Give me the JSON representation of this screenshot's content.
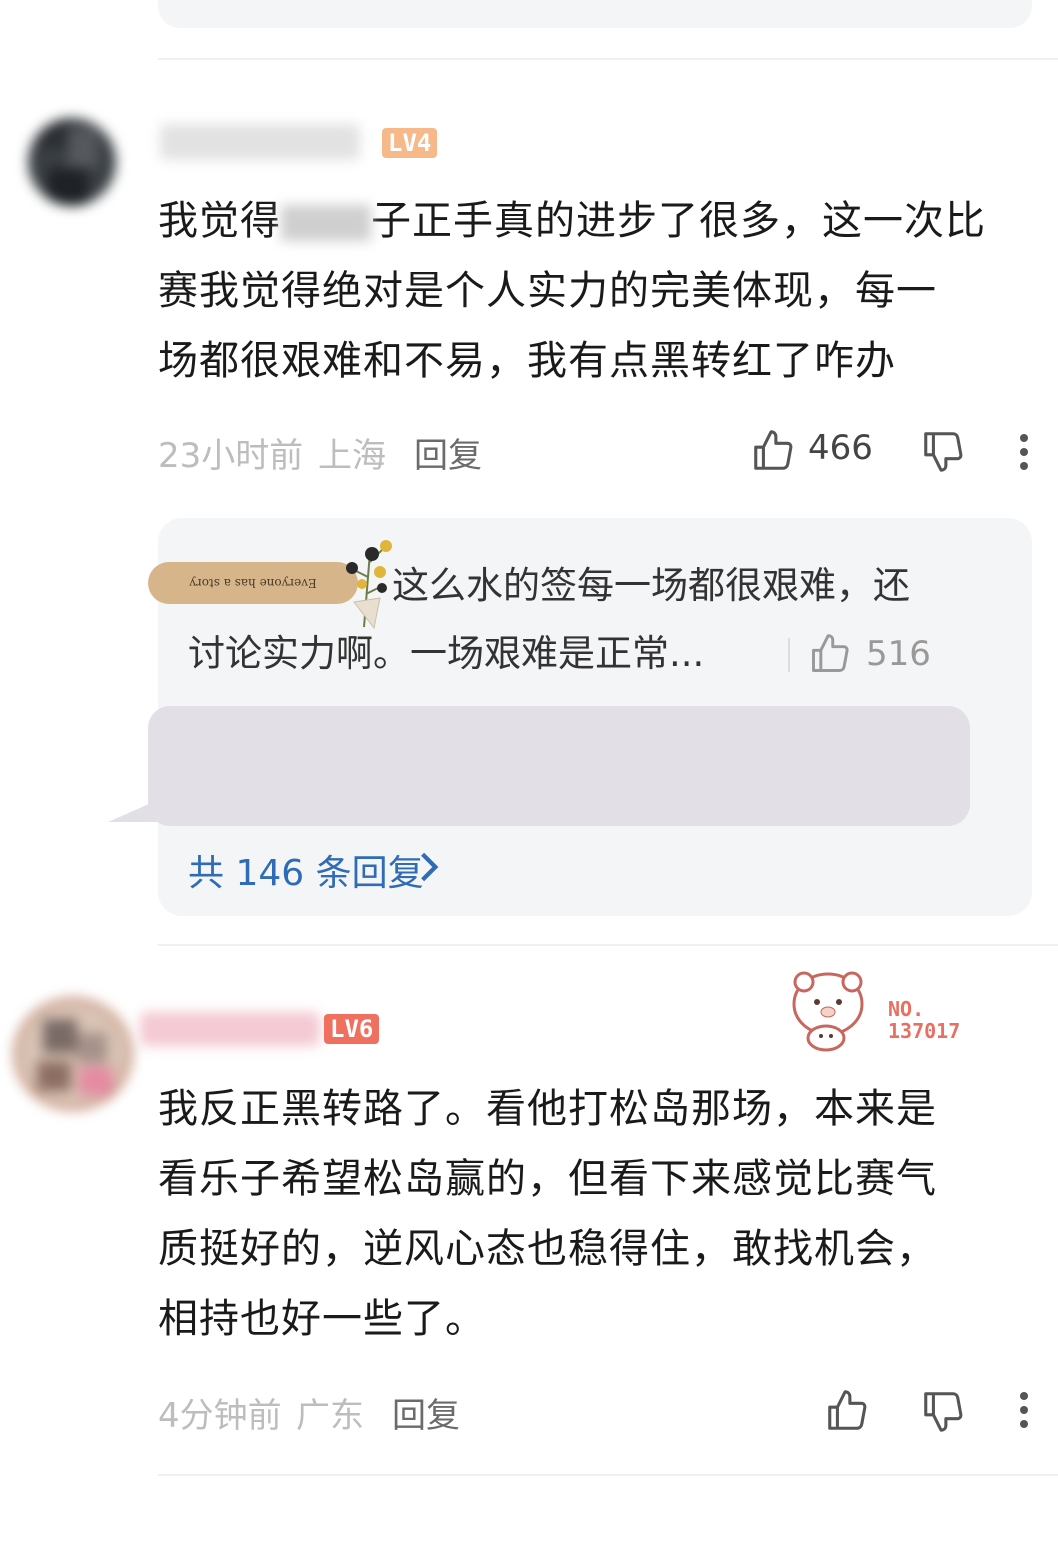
{
  "comments": [
    {
      "username": "",
      "level": "LV4",
      "content": [
        "我觉得",
        "子正手真的进步了很多，这一次比",
        "赛我觉得绝对是个人实力的完美体现，每一",
        "场都很艰难和不易，我有点黑转红了咋办"
      ],
      "time": "23小时前",
      "location": "上海",
      "reply_label": "回复",
      "likes": "466",
      "sub_reply": {
        "decoration_text": "Everyone has a story",
        "text_line1": "这么水的签每一场都很艰难，还",
        "text_line2": "讨论实力啊。一场艰难是正常...",
        "likes": "516"
      },
      "total_replies": "共 146 条回复"
    },
    {
      "username": "",
      "level": "LV6",
      "badge_no_label": "NO.",
      "badge_no_value": "137017",
      "content": [
        "我反正黑转路了。看他打松岛那场，本来是",
        "看乐子希望松岛赢的，但看下来感觉比赛气",
        "质挺好的，逆风心态也稳得住，敢找机会，",
        "相持也好一些了。"
      ],
      "time": "4分钟前",
      "location": "广东",
      "reply_label": "回复"
    }
  ],
  "icons": {
    "like": "thumbs-up-icon",
    "dislike": "thumbs-down-icon",
    "more": "more-vertical-icon",
    "chevron": "chevron-right-icon"
  },
  "colors": {
    "link_blue": "#2f6cb5",
    "meta_gray": "#bdbdbd",
    "card_bg": "#f4f5f7"
  }
}
